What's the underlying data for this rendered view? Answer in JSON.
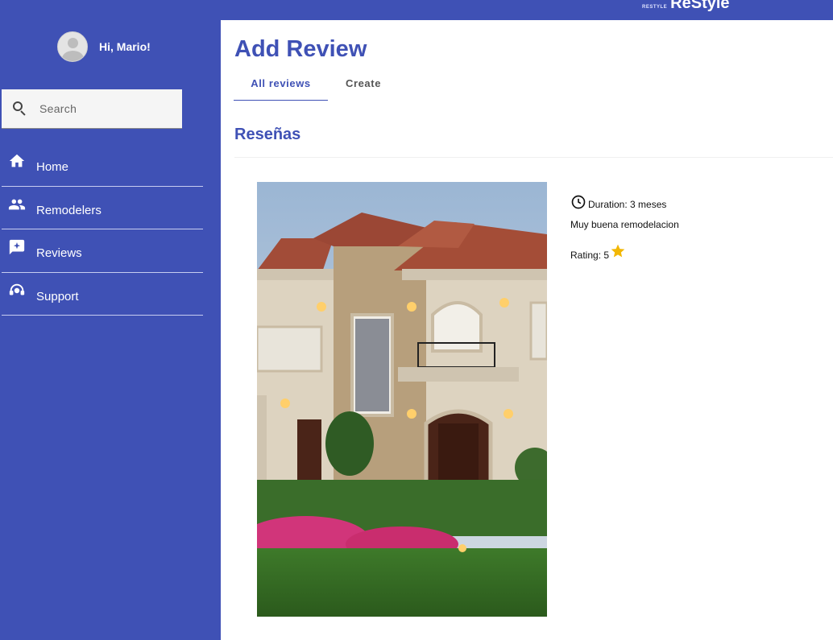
{
  "brand": {
    "tagline": "RESTYLE",
    "name": "ReStyle"
  },
  "sidebar": {
    "greeting": "Hi, Mario!",
    "search": {
      "placeholder": "Search",
      "value": ""
    },
    "items": [
      {
        "label": "Home",
        "icon": "home-icon"
      },
      {
        "label": "Remodelers",
        "icon": "people-icon"
      },
      {
        "label": "Reviews",
        "icon": "review-icon"
      },
      {
        "label": "Support",
        "icon": "support-icon"
      }
    ]
  },
  "main": {
    "title": "Add Review",
    "tabs": [
      {
        "label": "All reviews",
        "active": true
      },
      {
        "label": "Create",
        "active": false
      }
    ],
    "section_title": "Reseñas",
    "review": {
      "duration": "Duration: 3 meses",
      "description": "Muy buena remodelacion",
      "rating_label": "Rating: 5",
      "rating_value": 5,
      "image": "house-photo"
    }
  },
  "colors": {
    "primary": "#3f51b5",
    "star": "#f2b705",
    "white": "#ffffff"
  }
}
